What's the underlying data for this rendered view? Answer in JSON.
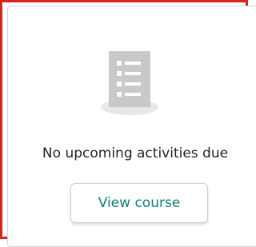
{
  "empty_state": {
    "icon": "document-list-icon",
    "message": "No upcoming activities due",
    "button_label": "View course"
  },
  "colors": {
    "highlight_border": "#d9231d",
    "button_text": "#147a7a",
    "icon_fill": "#c9c9c9",
    "icon_shadow": "#e8e8e8"
  }
}
